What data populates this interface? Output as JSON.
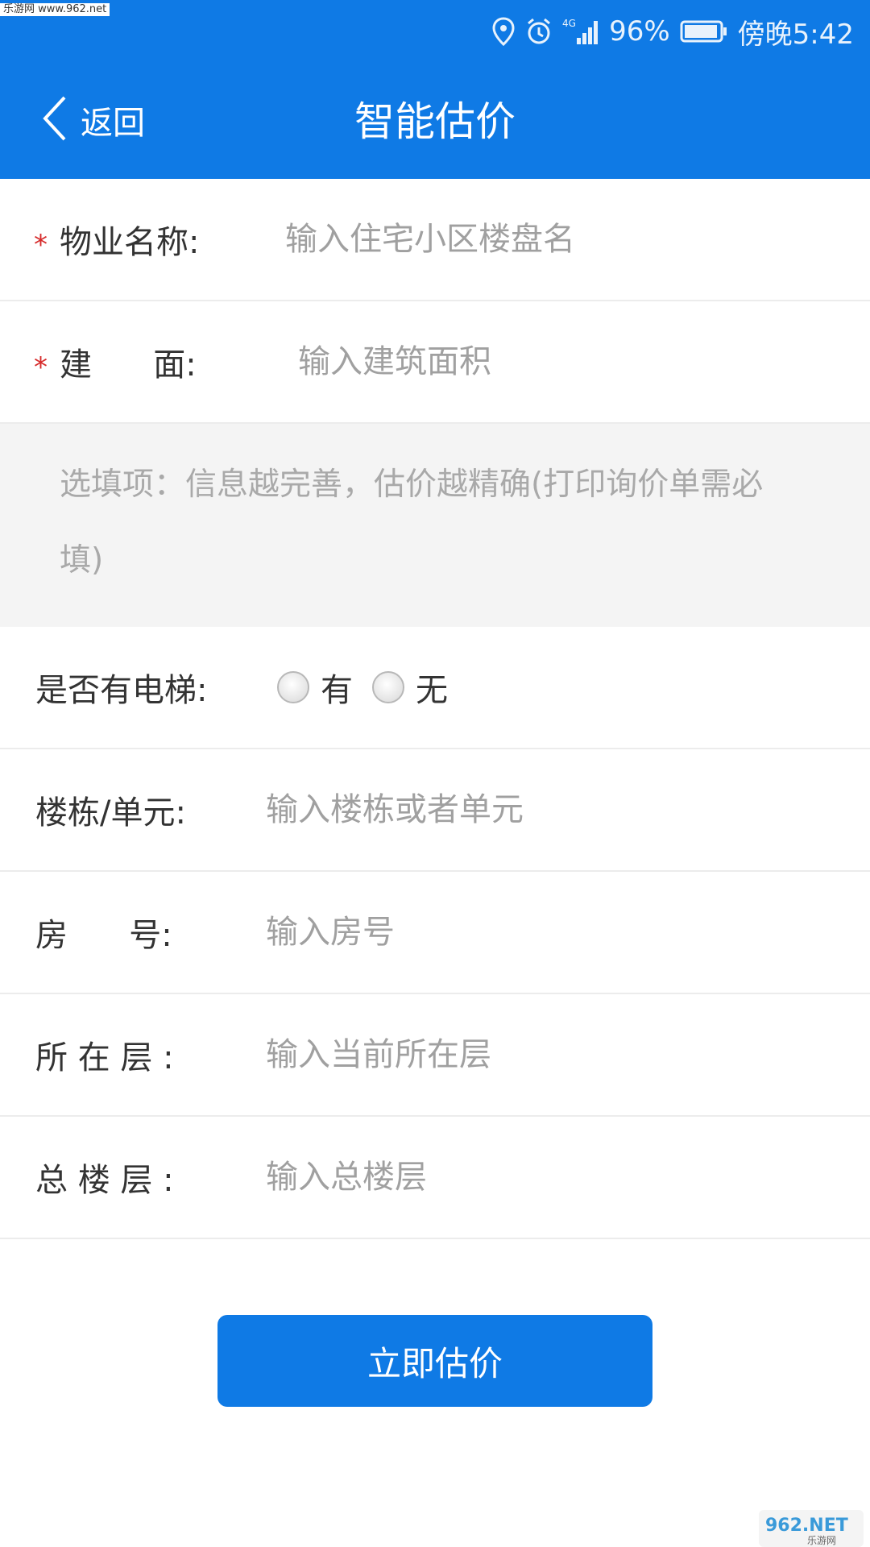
{
  "watermark_top": "乐游网 www.962.net",
  "status": {
    "signal_label": "4G",
    "battery": "96%",
    "time": "傍晚5:42"
  },
  "nav": {
    "back_label": "返回",
    "title": "智能估价"
  },
  "form": {
    "property_name": {
      "label": "物业名称:",
      "placeholder": "输入住宅小区楼盘名",
      "required": true
    },
    "area": {
      "label": "建      面:",
      "placeholder": "输入建筑面积",
      "required": true
    },
    "tip_line1": "选填项：信息越完善，估价越精确(打印询价单需必",
    "tip_line2": "填)",
    "elevator": {
      "label": "是否有电梯:",
      "options": [
        "有",
        "无"
      ]
    },
    "building": {
      "label": "楼栋/单元:",
      "placeholder": "输入楼栋或者单元"
    },
    "room": {
      "label": "房      号:",
      "placeholder": "输入房号"
    },
    "floor": {
      "label": "所 在 层 :",
      "placeholder": "输入当前所在层"
    },
    "total_floor": {
      "label": "总 楼 层 :",
      "placeholder": "输入总楼层"
    }
  },
  "submit_label": "立即估价",
  "watermark_bottom": "962.NET 乐游网",
  "colors": {
    "primary": "#0f7ae5",
    "required": "#d62b2b",
    "placeholder": "#a0a0a0"
  }
}
